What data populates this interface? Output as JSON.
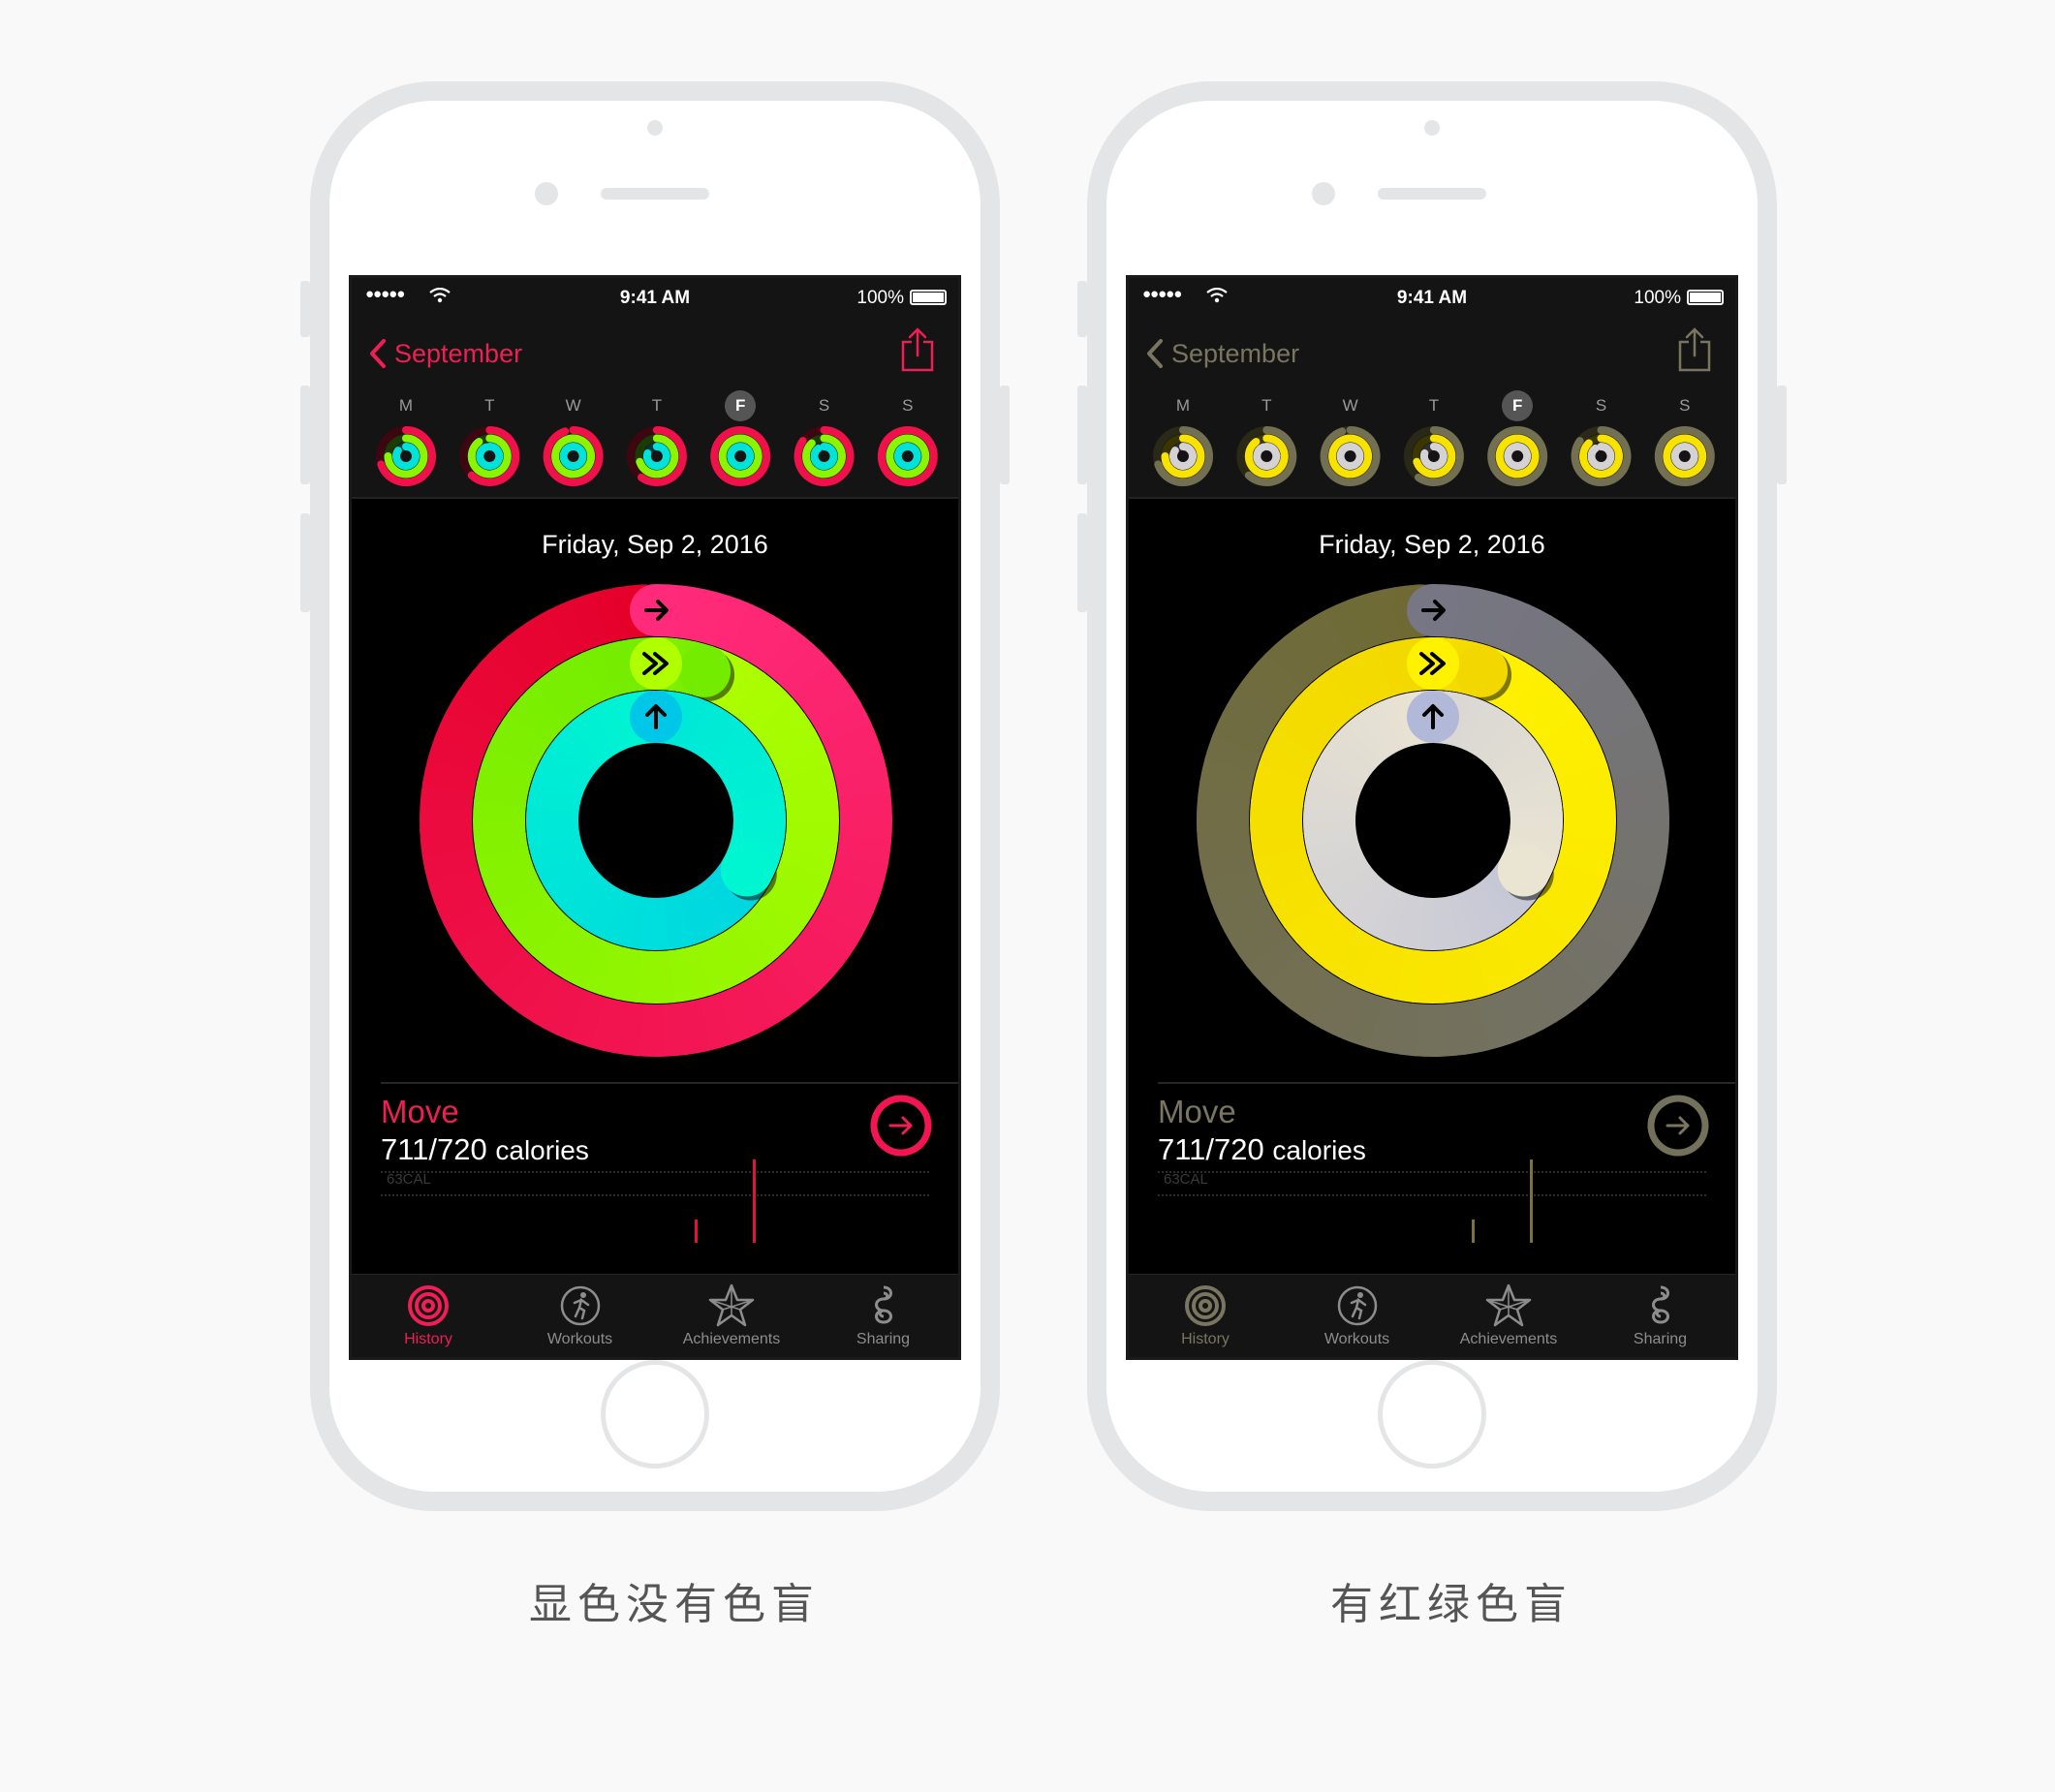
{
  "phones": [
    {
      "status": {
        "signal": "●●●●●",
        "time": "9:41 AM",
        "battery": "100%"
      },
      "nav": {
        "back_label": "September"
      },
      "weekdays": [
        "M",
        "T",
        "W",
        "T",
        "F",
        "S",
        "S"
      ],
      "selected_day": 4,
      "date_title": "Friday, Sep 2, 2016",
      "rings": {
        "move": {
          "progress": 0.99,
          "start": "#ff2a7a",
          "end": "#e5002a",
          "track": "#3d0611"
        },
        "exercise": {
          "progress": 1.05,
          "start": "#b0ff00",
          "end": "#73ec00",
          "track": "#1c3a03"
        },
        "stand": {
          "progress": 1.33,
          "start": "#00c6e8",
          "end": "#00f5d1",
          "track": "#003a3e"
        }
      },
      "mini_rings": [
        {
          "move": 0.7,
          "exercise": 0.75,
          "stand": 0.85
        },
        {
          "move": 0.62,
          "exercise": 0.9,
          "stand": 0.95
        },
        {
          "move": 0.95,
          "exercise": 1.0,
          "stand": 1.0
        },
        {
          "move": 0.6,
          "exercise": 0.7,
          "stand": 0.8
        },
        {
          "move": 0.99,
          "exercise": 1.0,
          "stand": 1.0
        },
        {
          "move": 0.85,
          "exercise": 0.88,
          "stand": 0.9
        },
        {
          "move": 1.0,
          "exercise": 1.0,
          "stand": 1.0
        }
      ],
      "move": {
        "label": "Move",
        "value": "711/720",
        "unit": "calories"
      },
      "chart": {
        "cal_label": "63CAL",
        "bar_color": "#e5103c"
      },
      "tabs": [
        {
          "label": "History",
          "icon": "history-icon",
          "active": true
        },
        {
          "label": "Workouts",
          "icon": "workouts-icon",
          "active": false
        },
        {
          "label": "Achievements",
          "icon": "achievements-icon",
          "active": false
        },
        {
          "label": "Sharing",
          "icon": "sharing-icon",
          "active": false
        }
      ],
      "accent": "#ee1f55",
      "caption": "显色没有色盲"
    },
    {
      "status": {
        "signal": "●●●●●",
        "time": "9:41 AM",
        "battery": "100%"
      },
      "nav": {
        "back_label": "September"
      },
      "weekdays": [
        "M",
        "T",
        "W",
        "T",
        "F",
        "S",
        "S"
      ],
      "selected_day": 4,
      "date_title": "Friday, Sep 2, 2016",
      "rings": {
        "move": {
          "progress": 0.99,
          "start": "#767684",
          "end": "#6f6a33",
          "track": "#2a2816"
        },
        "exercise": {
          "progress": 1.05,
          "start": "#fff200",
          "end": "#f2d800",
          "track": "#3a3600"
        },
        "stand": {
          "progress": 1.33,
          "start": "#b2b8d8",
          "end": "#eae4d2",
          "track": "#2e2e30"
        }
      },
      "mini_rings": [
        {
          "move": 0.7,
          "exercise": 0.75,
          "stand": 0.85
        },
        {
          "move": 0.62,
          "exercise": 0.9,
          "stand": 0.95
        },
        {
          "move": 0.95,
          "exercise": 1.0,
          "stand": 1.0
        },
        {
          "move": 0.6,
          "exercise": 0.7,
          "stand": 0.8
        },
        {
          "move": 0.99,
          "exercise": 1.0,
          "stand": 1.0
        },
        {
          "move": 0.85,
          "exercise": 0.88,
          "stand": 0.9
        },
        {
          "move": 1.0,
          "exercise": 1.0,
          "stand": 1.0
        }
      ],
      "move": {
        "label": "Move",
        "value": "711/720",
        "unit": "calories"
      },
      "chart": {
        "cal_label": "63CAL",
        "bar_color": "#7d7238"
      },
      "tabs": [
        {
          "label": "History",
          "icon": "history-icon",
          "active": true
        },
        {
          "label": "Workouts",
          "icon": "workouts-icon",
          "active": false
        },
        {
          "label": "Achievements",
          "icon": "achievements-icon",
          "active": false
        },
        {
          "label": "Sharing",
          "icon": "sharing-icon",
          "active": false
        }
      ],
      "accent": "#7a7560",
      "caption": "有红绿色盲"
    }
  ]
}
